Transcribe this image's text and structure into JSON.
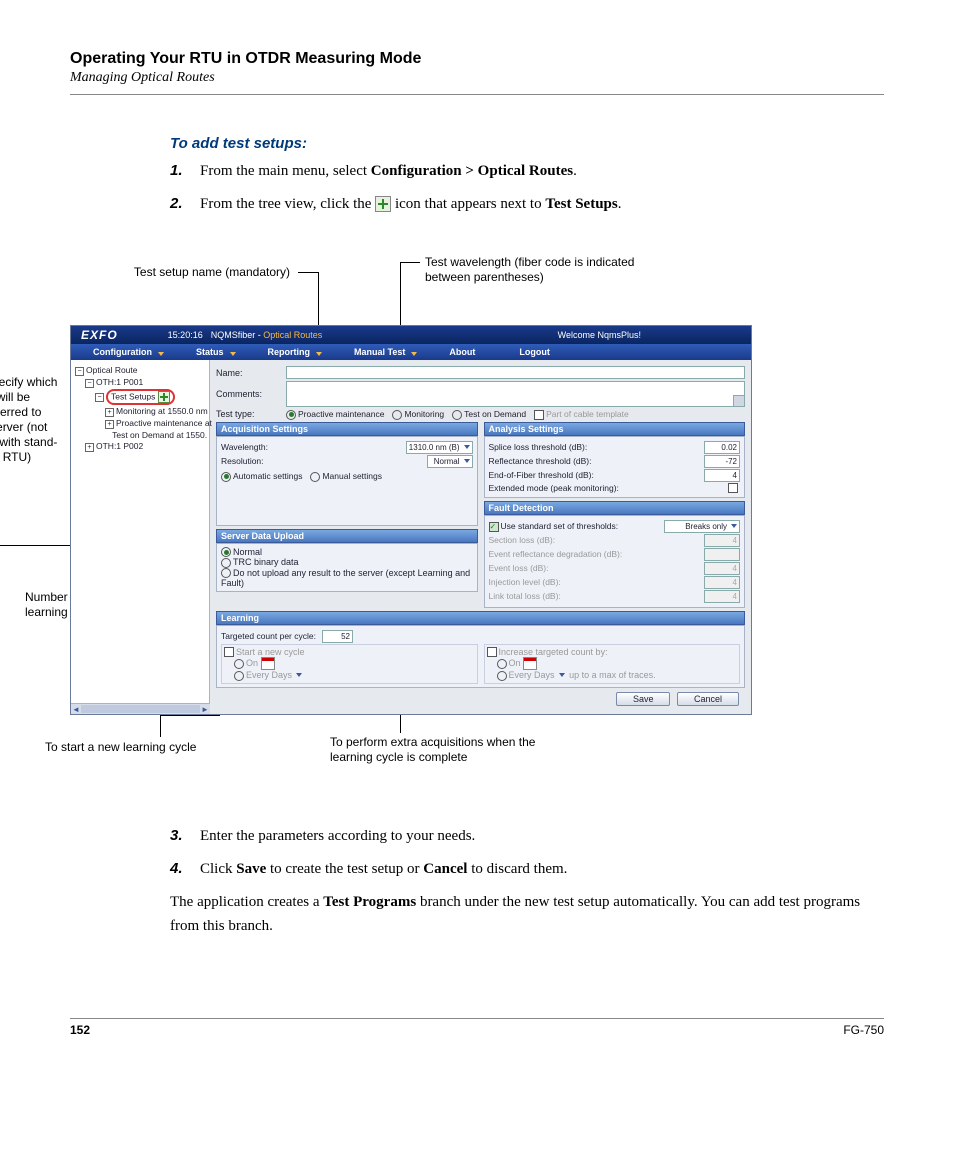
{
  "header": {
    "chapter": "Operating Your RTU in OTDR Measuring Mode",
    "section": "Managing Optical Routes"
  },
  "procedure": {
    "title": "To add test setups:",
    "step1_pre": "From the main menu, select ",
    "step1_bold": "Configuration > Optical Routes",
    "step1_post": ".",
    "step2_pre": "From the tree view, click the ",
    "step2_post": " icon that appears next to ",
    "step2_bold": "Test Setups",
    "step2_end": ".",
    "step3": "Enter the parameters according to your needs.",
    "step4_pre": "Click ",
    "step4_b1": "Save",
    "step4_mid": " to create the test setup or ",
    "step4_b2": "Cancel",
    "step4_post": " to discard them."
  },
  "postnote_pre": "The application creates a ",
  "postnote_bold": "Test Programs",
  "postnote_post": " branch under the new test setup automatically. You can add test programs from this branch.",
  "callouts": {
    "c1": "Test setup name (mandatory)",
    "c2": "Test wavelength (fiber code is indicated between parentheses)",
    "c3": "To specify which data will be transferred to the server (not used with stand-alone RTU)",
    "c4": "Number of acquisitions during a learning cycle",
    "c5": "To start a new learning cycle",
    "c6": "To perform extra acquisitions when the learning cycle is complete"
  },
  "screenshot": {
    "logo": "EXFO",
    "time": "15:20:16",
    "app": "NQMSfiber - ",
    "app_section": "Optical Routes",
    "welcome": "Welcome NqmsPlus!",
    "menu": {
      "m1": "Configuration",
      "m2": "Status",
      "m3": "Reporting",
      "m4": "Manual Test",
      "m5": "About",
      "m6": "Logout"
    },
    "tree": {
      "root": "Optical Route",
      "n1": "OTH:1 P001",
      "n2": "Test Setups",
      "n3": "Monitoring at 1550.0 nm",
      "n4": "Proactive maintenance at",
      "n5": "Test on Demand at 1550.",
      "n6": "OTH:1 P002"
    },
    "form": {
      "name_lbl": "Name:",
      "comments_lbl": "Comments:",
      "testtype_lbl": "Test type:",
      "tt_proactive": "Proactive maintenance",
      "tt_monitoring": "Monitoring",
      "tt_testondemand": "Test on Demand",
      "tt_cable": "Part of cable template",
      "acq_hdr": "Acquisition Settings",
      "wavelength_lbl": "Wavelength:",
      "wavelength_val": "1310.0 nm (B)",
      "resolution_lbl": "Resolution:",
      "resolution_val": "Normal",
      "auto": "Automatic settings",
      "manual": "Manual settings",
      "upload_hdr": "Server Data Upload",
      "up_normal": "Normal",
      "up_trc": "TRC binary data",
      "up_none": "Do not upload any result to the server (except Learning and Fault)",
      "analysis_hdr": "Analysis Settings",
      "a_splice": "Splice loss threshold (dB):",
      "a_splice_v": "0.02",
      "a_refl": "Reflectance threshold (dB):",
      "a_refl_v": "-72",
      "a_eof": "End-of-Fiber threshold (dB):",
      "a_eof_v": "4",
      "a_ext": "Extended mode (peak monitoring):",
      "fault_hdr": "Fault Detection",
      "fd_usestd": "Use standard set of thresholds:",
      "fd_usestd_v": "Breaks only",
      "fd_section": "Section loss (dB):",
      "fd_section_v": "4",
      "fd_evrefl": "Event reflectance degradation (dB):",
      "fd_evloss": "Event loss (dB):",
      "fd_evloss_v": "4",
      "fd_inj": "Injection level (dB):",
      "fd_inj_v": "4",
      "fd_link": "Link total loss (dB):",
      "fd_link_v": "4",
      "learn_hdr": "Learning",
      "learn_target": "Targeted count per cycle:",
      "learn_target_v": "52",
      "learn_start": "Start a new cycle",
      "learn_on": "On",
      "learn_every": "Every",
      "learn_days": "Days",
      "learn_increase": "Increase targeted count by:",
      "learn_upto": "up to a max of",
      "learn_traces": "traces.",
      "save": "Save",
      "cancel": "Cancel"
    }
  },
  "footer": {
    "page": "152",
    "doc": "FG-750"
  }
}
